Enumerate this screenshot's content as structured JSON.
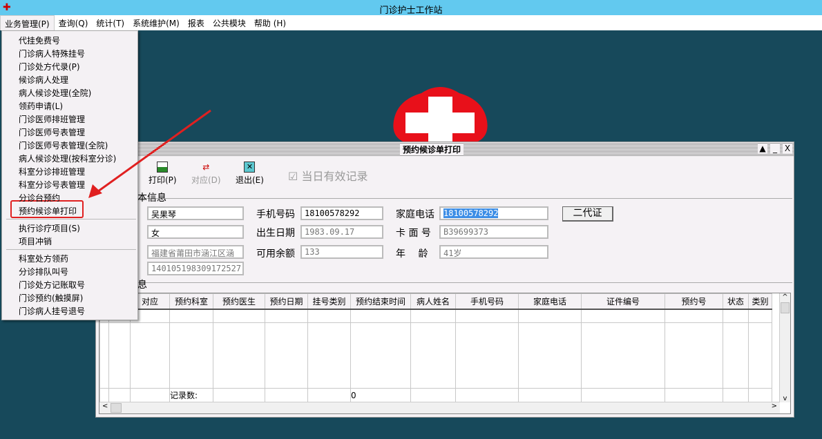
{
  "app": {
    "title": "门诊护士工作站"
  },
  "menubar": [
    "业务管理(P)",
    "查询(Q)",
    "统计(T)",
    "系统维护(M)",
    "报表",
    "公共模块",
    "帮助 (H)"
  ],
  "dropdown": {
    "group1": [
      "代挂免费号",
      "门诊病人特殊挂号",
      "门诊处方代录(P)",
      "候诊病人处理",
      "病人候诊处理(全院)",
      "领药申请(L)",
      "门诊医师排班管理",
      "门诊医师号表管理",
      "门诊医师号表管理(全院)",
      "病人候诊处理(按科室分诊)",
      "科室分诊排班管理",
      "科室分诊号表管理",
      "分诊台预约",
      "预约候诊单打印"
    ],
    "group2": [
      "执行诊疗项目(S)",
      "项目冲销"
    ],
    "group3": [
      "科室处方领药",
      "分诊排队叫号",
      "门诊处方记账取号",
      "门诊预约(触摸屏)",
      "门诊病人挂号退号"
    ],
    "highlighted": "预约候诊单打印"
  },
  "window": {
    "title": "预约候诊单打印",
    "controls": [
      "▲",
      "_",
      "X"
    ],
    "toolbar": {
      "print": "打印(P)",
      "match": "对应(D)",
      "exit": "退出(E)",
      "valid_today": "当日有效记录",
      "valid_today_checked": true
    },
    "group_basic": "本信息",
    "group_list": "息",
    "fields": {
      "name": "吴果琴",
      "gender": "女",
      "address": "福建省莆田市涵江区涵",
      "id_no": "140105198309172527",
      "mobile_label": "手机号码",
      "mobile": "18100578292",
      "birth_label": "出生日期",
      "birth": "1983.09.17",
      "balance_label": "可用余额",
      "balance": "133",
      "home_label": "家庭电话",
      "home": "18100578292",
      "card_label": "卡 面 号",
      "card": "B39699373",
      "age_label": "年　 龄",
      "age": "41岁"
    },
    "id_card_button": "二代证",
    "table": {
      "columns": [
        "",
        "对应",
        "预约科室",
        "预约医生",
        "预约日期",
        "挂号类别",
        "预约结束时间",
        "病人姓名",
        "手机号码",
        "家庭电话",
        "证件编号",
        "预约号",
        "状态",
        "类别"
      ],
      "footer_label": "记录数:",
      "record_count": "0"
    }
  },
  "colors": {
    "titlebar": "#62c9ef",
    "desktop": "#17495b",
    "highlight_box": "#e02020",
    "selection": "#3d8ee6"
  }
}
